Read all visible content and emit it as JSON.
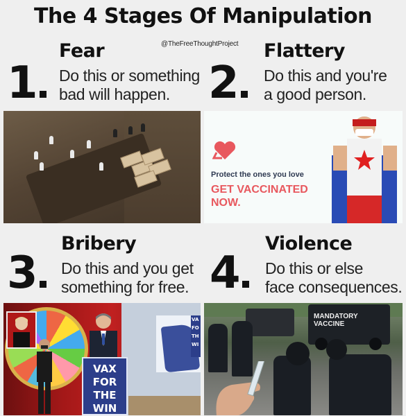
{
  "title": "The 4 Stages Of Manipulation",
  "credit": "@TheFreeThoughtProject",
  "stages": [
    {
      "number": "1",
      "name": "Fear",
      "lines": [
        "Do this or something",
        "bad will happen."
      ]
    },
    {
      "number": "2",
      "name": "Flattery",
      "lines": [
        "Do this and you're",
        "a good person."
      ]
    },
    {
      "number": "3",
      "name": "Bribery",
      "lines": [
        "Do this and you get",
        "something for free."
      ]
    },
    {
      "number": "4",
      "name": "Violence",
      "lines": [
        "Do this or else",
        "face consequences."
      ]
    }
  ],
  "panel2": {
    "line1": "Protect the ones you love",
    "line2": "GET VACCINATED NOW."
  },
  "panel3": {
    "podium": [
      "VAX",
      "FOR",
      "THE",
      "WIN"
    ],
    "sign": "VA FO TH WI"
  },
  "panel4": {
    "truck_label": [
      "MANDATORY",
      "VACCINE"
    ]
  },
  "colors": {
    "ad_heading": "#2f3a52",
    "ad_cta": "#e8585e",
    "ad_accent": "#38c7b3",
    "podium": "#2c3e8a"
  }
}
